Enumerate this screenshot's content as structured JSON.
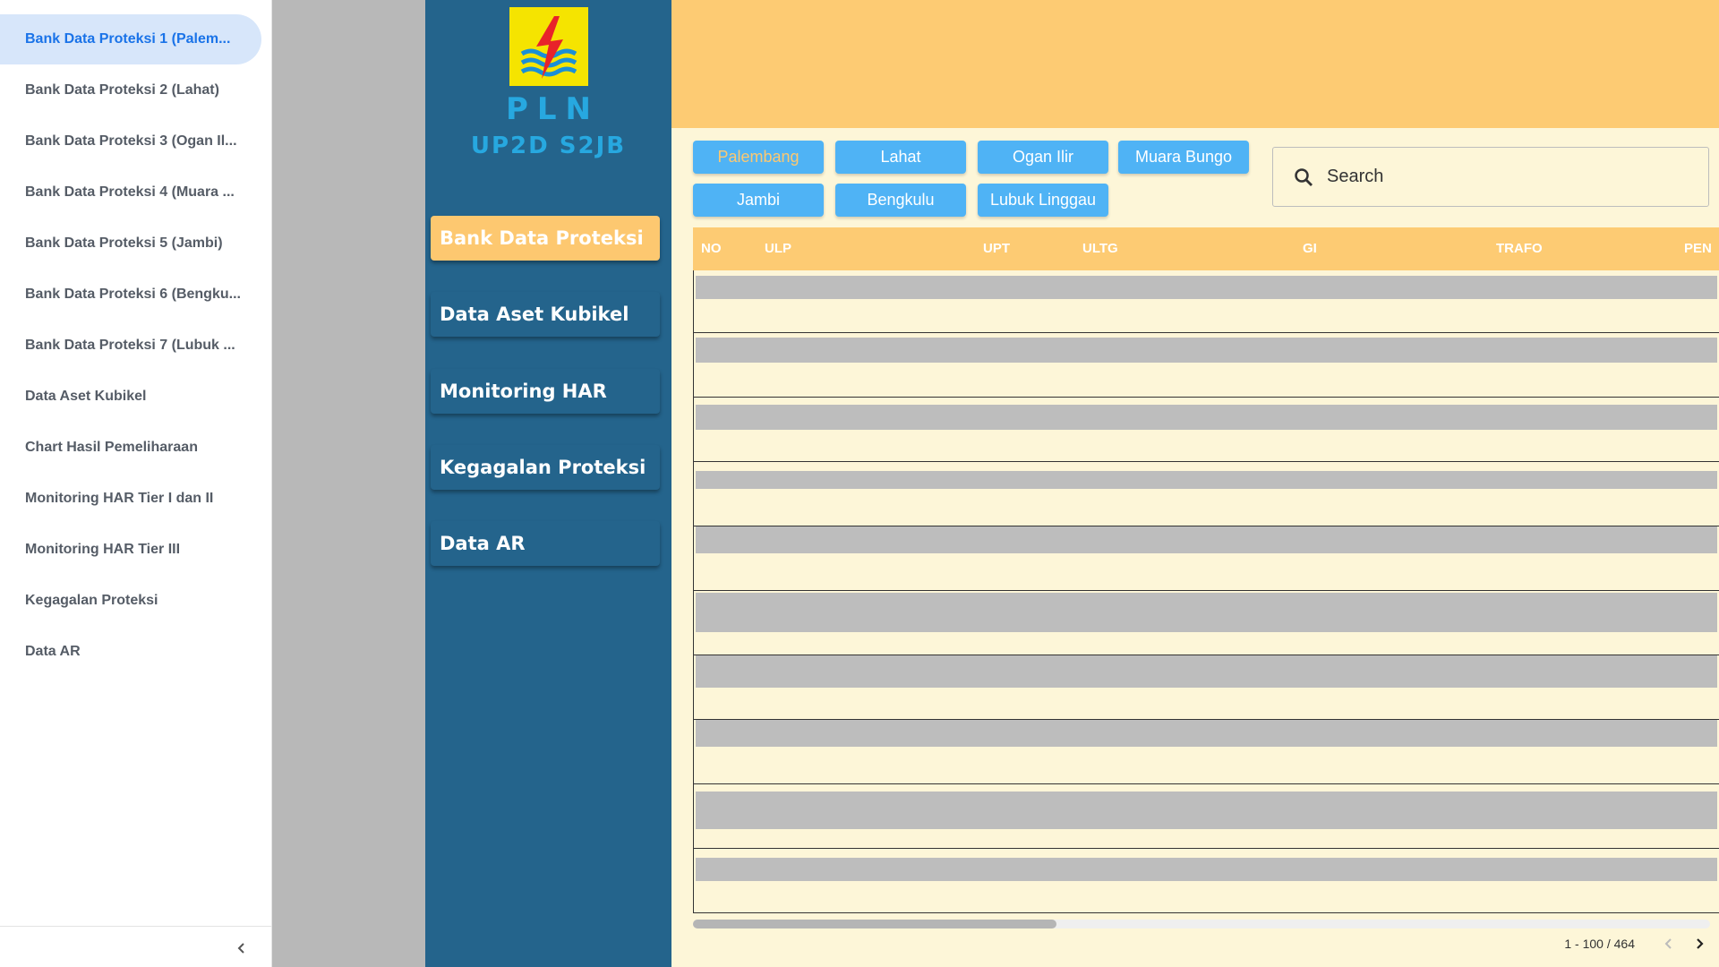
{
  "pages_nav": {
    "items": [
      {
        "label": "Bank Data Proteksi 1 (Palem...",
        "active": true
      },
      {
        "label": "Bank Data Proteksi 2 (Lahat)"
      },
      {
        "label": "Bank Data Proteksi 3 (Ogan Il..."
      },
      {
        "label": "Bank Data Proteksi 4 (Muara ..."
      },
      {
        "label": "Bank Data Proteksi 5 (Jambi)"
      },
      {
        "label": "Bank Data Proteksi 6 (Bengku..."
      },
      {
        "label": "Bank Data Proteksi 7 (Lubuk ..."
      },
      {
        "label": "Data Aset Kubikel"
      },
      {
        "label": "Chart Hasil Pemeliharaan"
      },
      {
        "label": "Monitoring HAR Tier I dan II"
      },
      {
        "label": "Monitoring HAR Tier III"
      },
      {
        "label": "Kegagalan Proteksi"
      },
      {
        "label": "Data AR"
      }
    ],
    "collapse_icon": "chevron-left-icon"
  },
  "app_menu": {
    "logo_icon": "pln-lightning-logo",
    "brand_name": "PLN",
    "brand_unit": "UP2D S2JB",
    "items": [
      {
        "label": "Bank Data Proteksi",
        "active": true
      },
      {
        "label": "Data Aset Kubikel"
      },
      {
        "label": "Monitoring HAR"
      },
      {
        "label": "Kegagalan Proteksi"
      },
      {
        "label": "Data AR"
      }
    ]
  },
  "filters": [
    {
      "label": "Palembang",
      "active": true
    },
    {
      "label": "Lahat"
    },
    {
      "label": "Ogan Ilir"
    },
    {
      "label": "Muara Bungo"
    },
    {
      "label": "Jambi"
    },
    {
      "label": "Bengkulu"
    },
    {
      "label": "Lubuk Linggau"
    }
  ],
  "search": {
    "placeholder": "Search",
    "icon": "search-icon"
  },
  "table": {
    "columns": [
      "NO",
      "ULP",
      "UPT",
      "ULTG",
      "GI",
      "TRAFO",
      "PEN"
    ]
  },
  "pagination": {
    "range": "1 - 100 / 464",
    "prev_icon": "chevron-left-icon",
    "next_icon": "chevron-right-icon"
  },
  "colors": {
    "accent_yellow": "#fdcb73",
    "menu_blue": "#24648c",
    "filter_blue": "#4fb3f5",
    "active_nav": "#1a73e8",
    "row_band": "#bdbdbd",
    "table_bg": "#fdf6d8"
  }
}
